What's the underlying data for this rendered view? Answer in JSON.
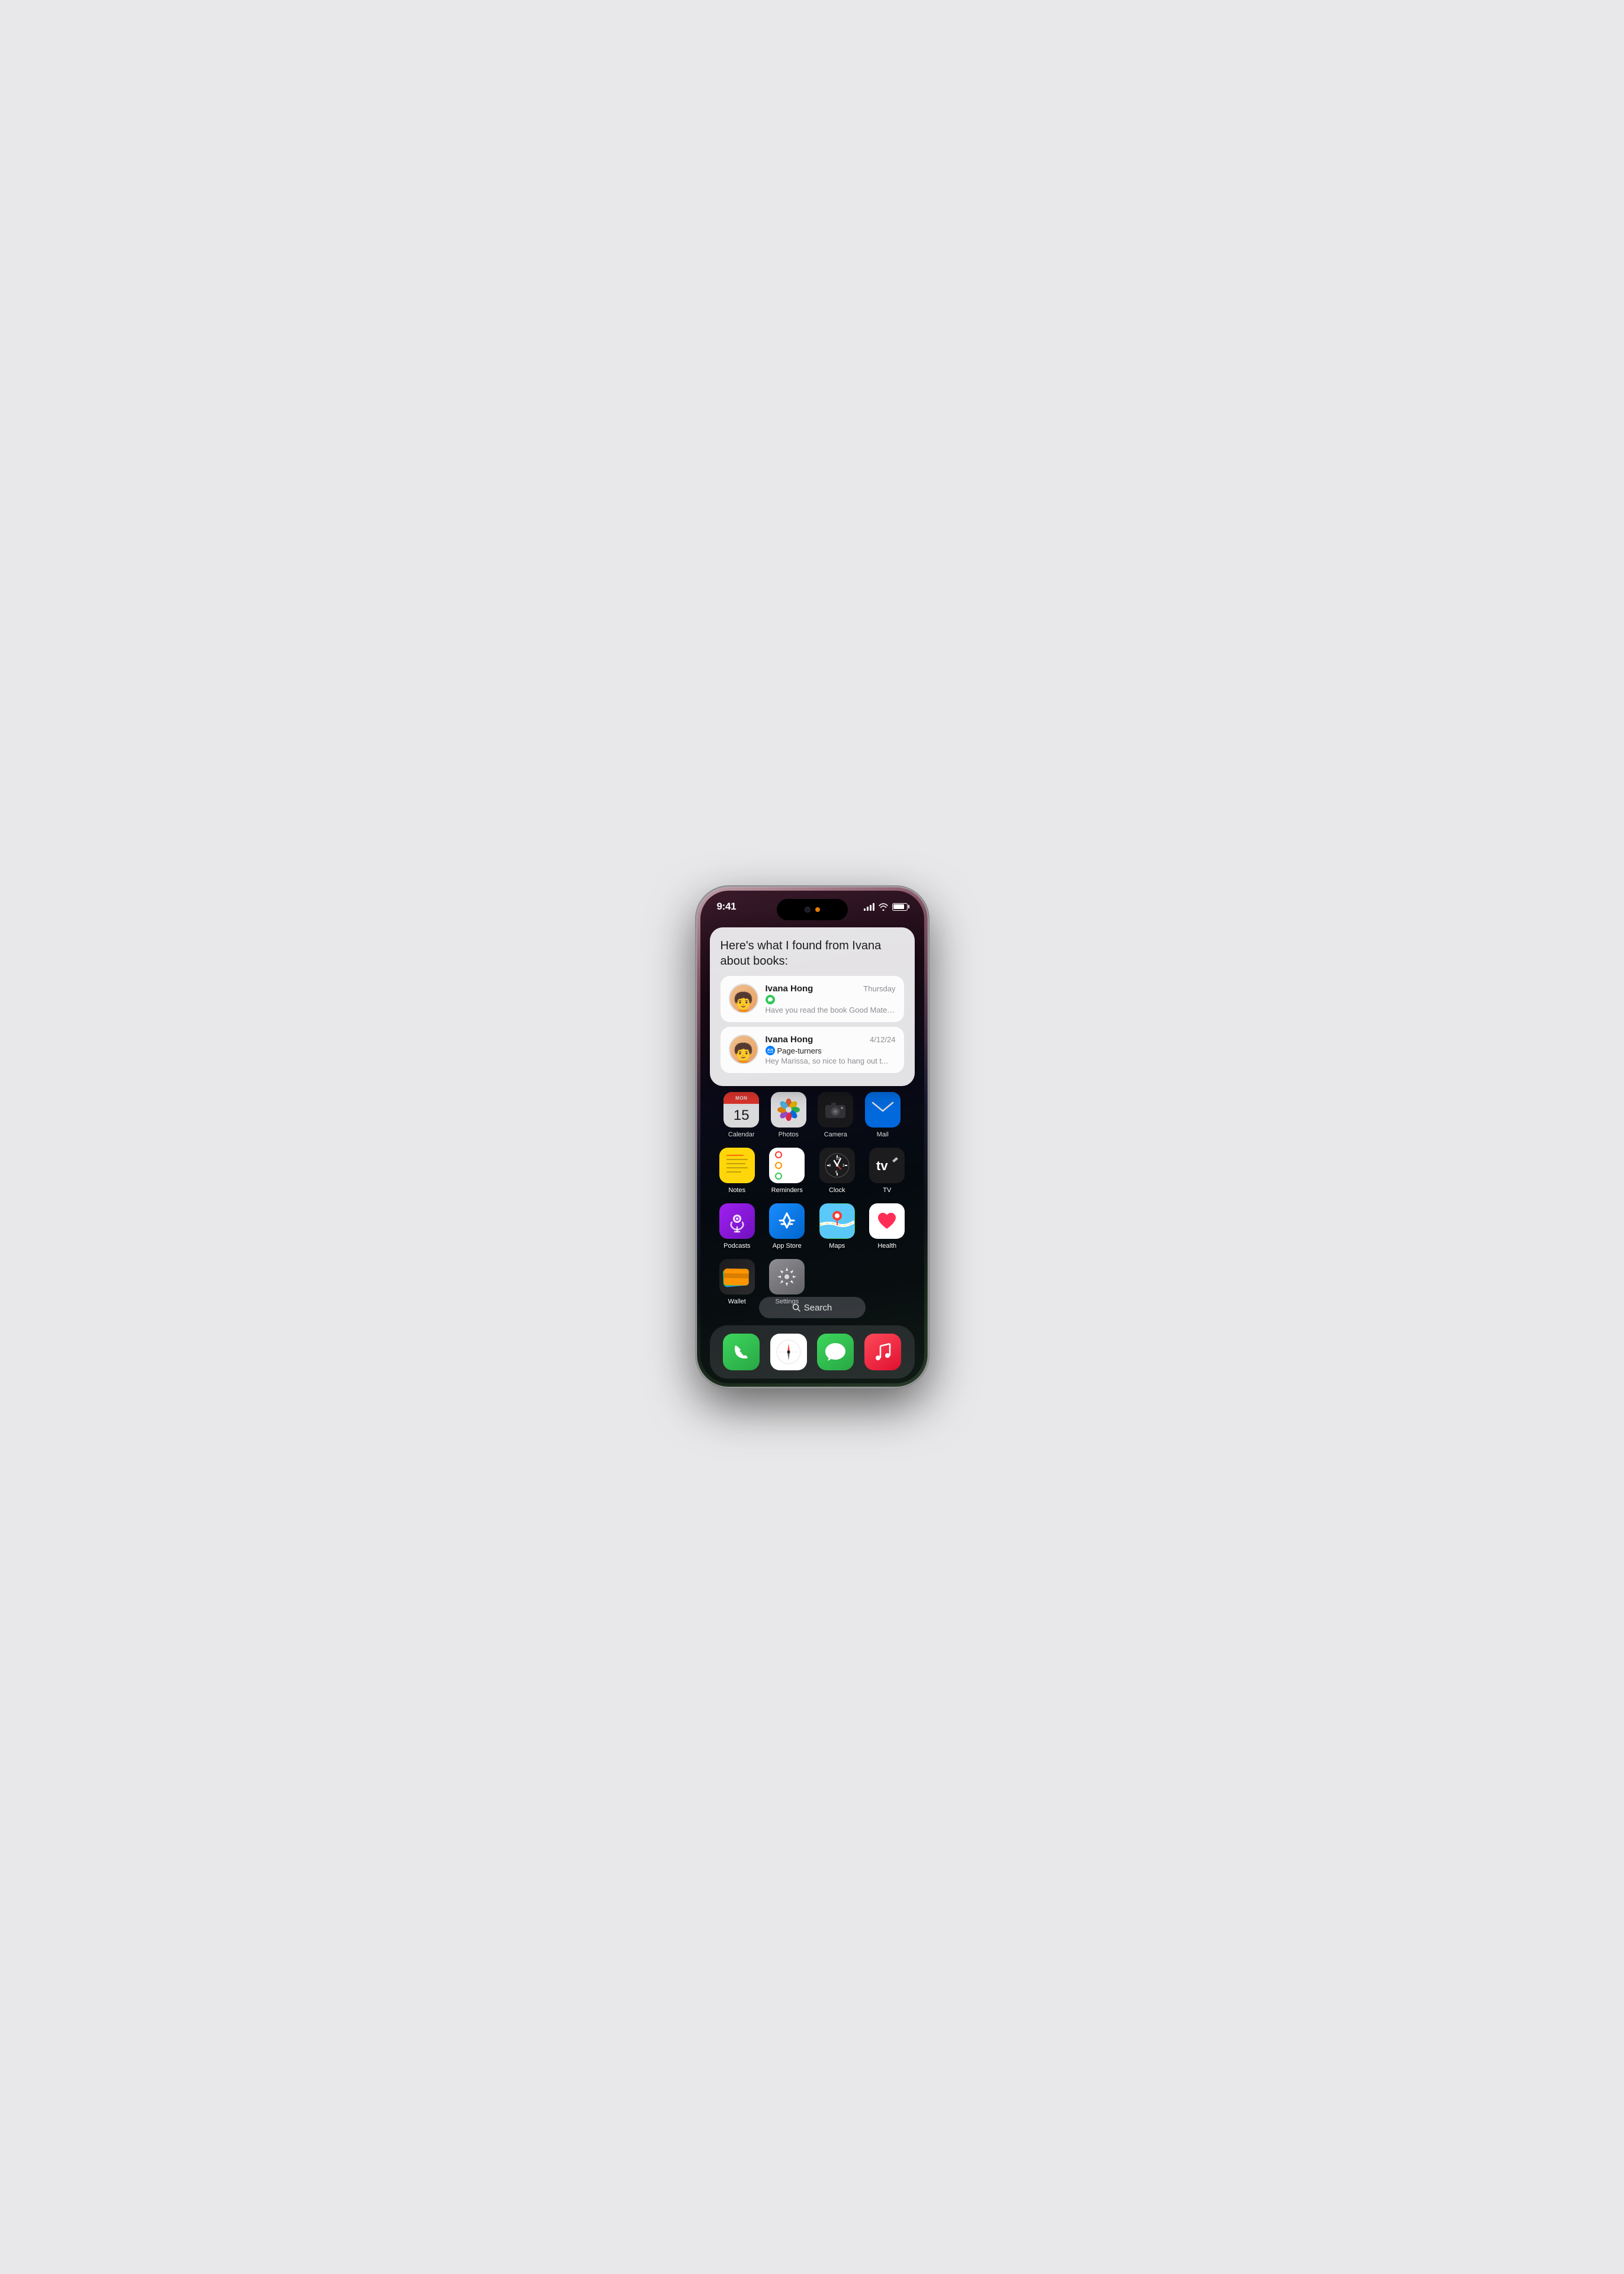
{
  "phone": {
    "status_bar": {
      "time": "9:41",
      "signal_label": "signal",
      "wifi_label": "wifi",
      "battery_label": "battery"
    },
    "siri_card": {
      "header": "Here's what I found from Ivana about books:",
      "results": [
        {
          "name": "Ivana Hong",
          "date": "Thursday",
          "app_type": "messages",
          "subject": "",
          "preview": "Have you read the book Good Material yet? Just read it with my b..."
        },
        {
          "name": "Ivana Hong",
          "date": "4/12/24",
          "app_type": "mail",
          "subject": "Page-turners",
          "preview": "Hey Marissa, so nice to hang out t..."
        }
      ]
    },
    "dock_top": {
      "apps": [
        {
          "id": "calendar",
          "label": "Calendar",
          "day": "15",
          "month": "MON"
        },
        {
          "id": "photos",
          "label": "Photos"
        },
        {
          "id": "camera",
          "label": "Camera"
        },
        {
          "id": "mail",
          "label": "Mail"
        }
      ]
    },
    "app_rows": [
      {
        "apps": [
          {
            "id": "notes",
            "label": "Notes"
          },
          {
            "id": "reminders",
            "label": "Reminders"
          },
          {
            "id": "clock",
            "label": "Clock"
          },
          {
            "id": "tv",
            "label": "TV"
          }
        ]
      },
      {
        "apps": [
          {
            "id": "podcasts",
            "label": "Podcasts"
          },
          {
            "id": "appstore",
            "label": "App Store"
          },
          {
            "id": "maps",
            "label": "Maps"
          },
          {
            "id": "health",
            "label": "Health"
          }
        ]
      },
      {
        "apps": [
          {
            "id": "wallet",
            "label": "Wallet"
          },
          {
            "id": "settings",
            "label": "Settings"
          },
          {
            "id": "empty1",
            "label": ""
          },
          {
            "id": "empty2",
            "label": ""
          }
        ]
      }
    ],
    "search": {
      "label": "Search",
      "placeholder": "Search"
    },
    "dock": {
      "apps": [
        {
          "id": "phone",
          "label": "Phone"
        },
        {
          "id": "safari",
          "label": "Safari"
        },
        {
          "id": "messages",
          "label": "Messages"
        },
        {
          "id": "music",
          "label": "Music"
        }
      ]
    }
  }
}
